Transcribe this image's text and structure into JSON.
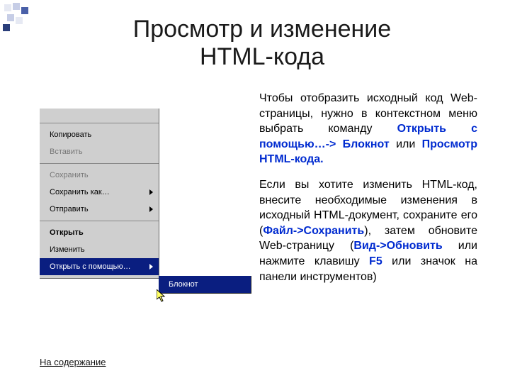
{
  "title_line1": "Просмотр и изменение",
  "title_line2": "HTML-кода",
  "context_menu": {
    "copy": "Копировать",
    "paste": "Вставить",
    "save": "Сохранить",
    "save_as": "Сохранить как…",
    "send": "Отправить",
    "open": "Открыть",
    "edit": "Изменить",
    "open_with": "Открыть с помощью…",
    "submenu": {
      "notepad": "Блокнот"
    }
  },
  "para1": {
    "t1": "Чтобы отобразить исходный код Web-страницы, нужно в контекстном меню выбрать команду ",
    "h1": "Открыть с помощью…-> Блокнот",
    "t2": " или ",
    "h2": "Просмотр HTML-кода."
  },
  "para2": {
    "t1": "Если вы хотите изменить HTML-код, внесите необходимые изменения в исходный HTML-документ, сохраните его (",
    "h1": "Файл->Сохранить",
    "t2": "), затем обновите Web-страницу (",
    "h2": "Вид->Обновить",
    "t3": " или нажмите клавишу ",
    "h3": "F5",
    "t4": " или значок  на панели инструментов)"
  },
  "back_link": "На содержание"
}
